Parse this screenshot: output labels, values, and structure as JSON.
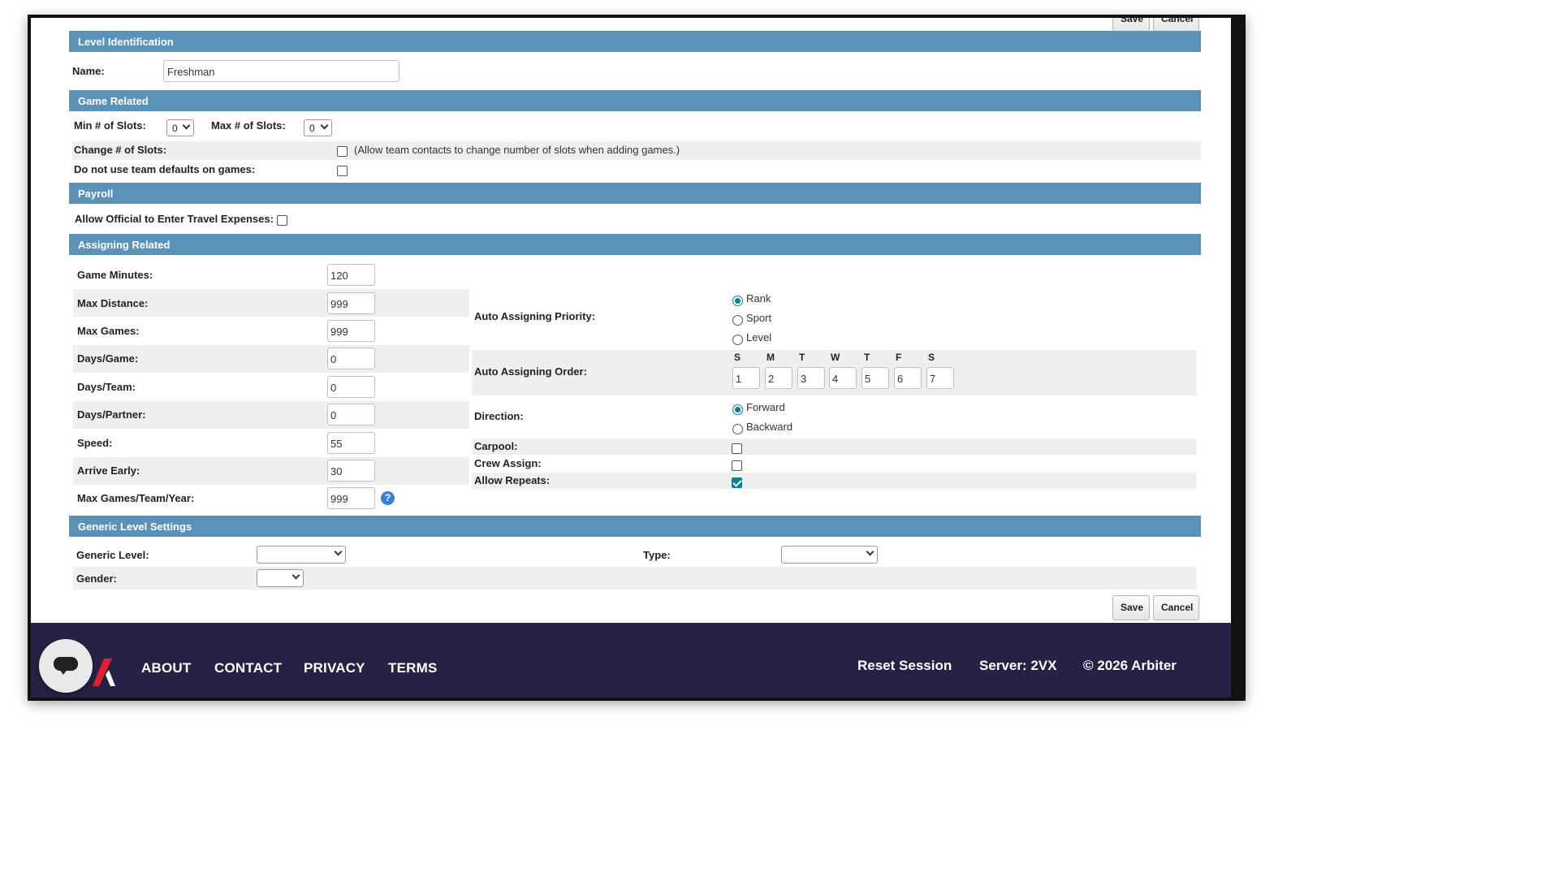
{
  "actions": {
    "save_label": "Save",
    "cancel_label": "Cancel"
  },
  "level_identification": {
    "header": "Level Identification",
    "name_label": "Name:",
    "name_value": "Freshman"
  },
  "game_related": {
    "header": "Game Related",
    "min_slots_label": "Min # of Slots:",
    "min_slots_value": "0",
    "max_slots_label": "Max # of Slots:",
    "max_slots_value": "0",
    "change_slots_label": "Change # of Slots:",
    "change_slots_note": "(Allow team contacts to change number of slots when adding games.)",
    "change_slots_checked": false,
    "no_team_defaults_label": "Do not use team defaults on games:",
    "no_team_defaults_checked": false
  },
  "payroll": {
    "header": "Payroll",
    "travel_expenses_label": "Allow Official to Enter Travel Expenses:",
    "travel_expenses_checked": false
  },
  "assigning_related": {
    "header": "Assigning Related",
    "fields": [
      {
        "label": "Game Minutes:",
        "value": "120"
      },
      {
        "label": "Max Distance:",
        "value": "999"
      },
      {
        "label": "Max Games:",
        "value": "999"
      },
      {
        "label": "Days/Game:",
        "value": "0"
      },
      {
        "label": "Days/Team:",
        "value": "0"
      },
      {
        "label": "Days/Partner:",
        "value": "0"
      },
      {
        "label": "Speed:",
        "value": "55"
      },
      {
        "label": "Arrive Early:",
        "value": "30"
      },
      {
        "label": "Max Games/Team/Year:",
        "value": "999"
      }
    ],
    "priority_label": "Auto Assigning Priority:",
    "priority_options": [
      "Rank",
      "Sport",
      "Level"
    ],
    "priority_selected": "Rank",
    "order_label": "Auto Assigning Order:",
    "order_days": [
      "S",
      "M",
      "T",
      "W",
      "T",
      "F",
      "S"
    ],
    "order_values": [
      "1",
      "2",
      "3",
      "4",
      "5",
      "6",
      "7"
    ],
    "direction_label": "Direction:",
    "direction_options": [
      "Forward",
      "Backward"
    ],
    "direction_selected": "Forward",
    "carpool_label": "Carpool:",
    "carpool_checked": false,
    "crew_assign_label": "Crew Assign:",
    "crew_assign_checked": false,
    "allow_repeats_label": "Allow Repeats:",
    "allow_repeats_checked": true
  },
  "generic_level_settings": {
    "header": "Generic Level Settings",
    "generic_level_label": "Generic Level:",
    "generic_level_value": "",
    "type_label": "Type:",
    "type_value": "",
    "gender_label": "Gender:",
    "gender_value": ""
  },
  "footer": {
    "links": [
      "ABOUT",
      "CONTACT",
      "PRIVACY",
      "TERMS"
    ],
    "reset_session": "Reset Session",
    "server": "Server: 2VX",
    "copyright": "© 2026 Arbiter"
  },
  "colors": {
    "section_header": "#5b93b8",
    "footer_bg": "#262145",
    "checked_accent": "#0f7c9a",
    "logo_red": "#e0202b"
  }
}
